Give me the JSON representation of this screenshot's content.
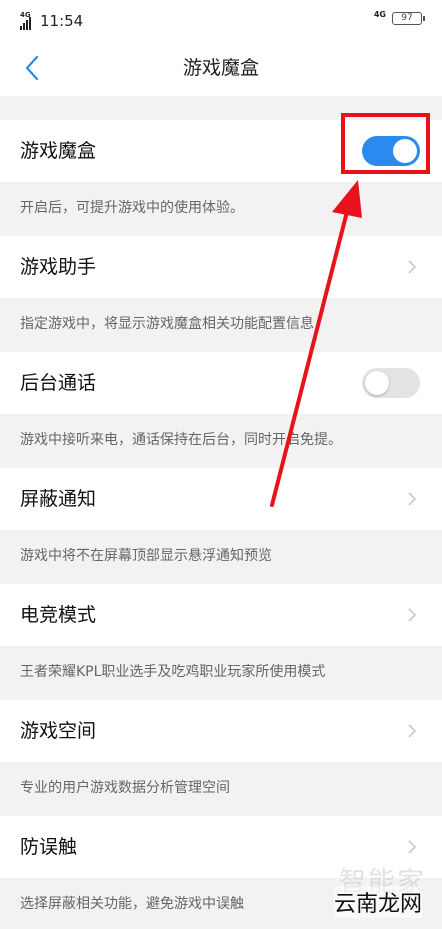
{
  "status_bar": {
    "time": "11:54",
    "network_left": "4G",
    "network_right": "4G",
    "battery": "97"
  },
  "header": {
    "title": "游戏魔盒"
  },
  "items": [
    {
      "label": "游戏魔盒",
      "desc": "开启后，可提升游戏中的使用体验。",
      "control": "toggle",
      "on": true
    },
    {
      "label": "游戏助手",
      "desc": "指定游戏中，将显示游戏魔盒相关功能配置信息",
      "control": "chevron"
    },
    {
      "label": "后台通话",
      "desc": "游戏中接听来电，通话保持在后台，同时开启免提。",
      "control": "toggle",
      "on": false
    },
    {
      "label": "屏蔽通知",
      "desc": "游戏中将不在屏幕顶部显示悬浮通知预览",
      "control": "chevron"
    },
    {
      "label": "电竞模式",
      "desc": "王者荣耀KPL职业选手及吃鸡职业玩家所使用模式",
      "control": "chevron"
    },
    {
      "label": "游戏空间",
      "desc": "专业的用户游戏数据分析管理空间",
      "control": "chevron"
    },
    {
      "label": "防误触",
      "desc": "选择屏蔽相关功能，避免游戏中误触",
      "control": "chevron"
    }
  ],
  "watermark": {
    "text_top": "智能家",
    "text_bottom": "云南龙网"
  },
  "colors": {
    "accent": "#2b8af0",
    "annotation": "#e8121a"
  }
}
